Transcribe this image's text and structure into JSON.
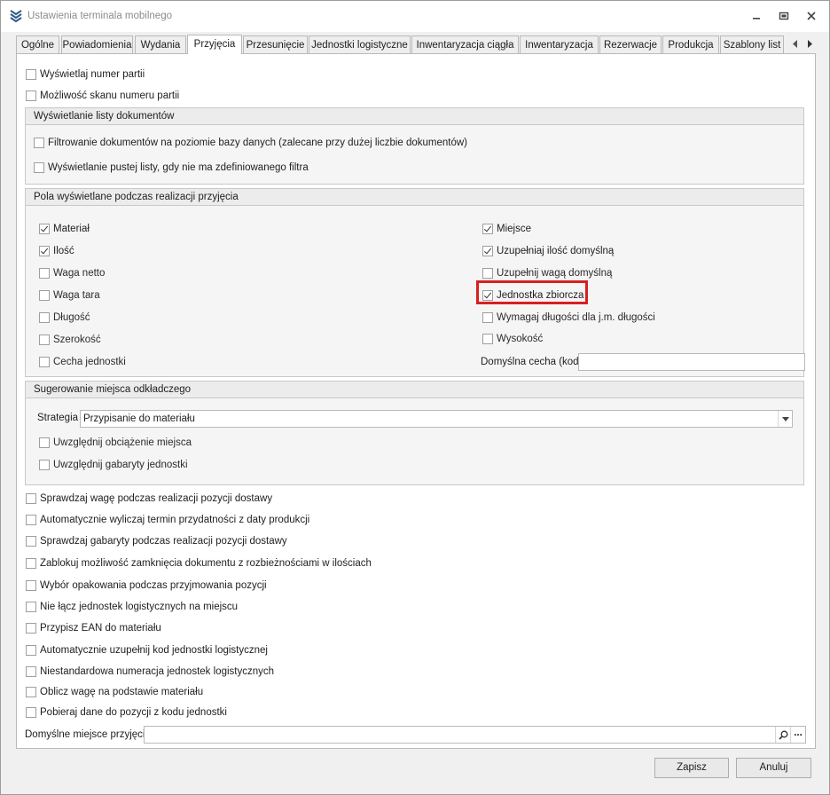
{
  "window": {
    "title": "Ustawienia terminala mobilnego",
    "icon": "app-logo-icon"
  },
  "tabs": [
    {
      "label": "Ogólne"
    },
    {
      "label": "Powiadomienia"
    },
    {
      "label": "Wydania"
    },
    {
      "label": "Przyjęcia",
      "active": true
    },
    {
      "label": "Przesunięcie"
    },
    {
      "label": "Jednostki logistyczne"
    },
    {
      "label": "Inwentaryzacja ciągła"
    },
    {
      "label": "Inwentaryzacja"
    },
    {
      "label": "Rezerwacje"
    },
    {
      "label": "Produkcja"
    },
    {
      "label": "Szablony list"
    }
  ],
  "top_options": [
    {
      "label": "Wyświetlaj numer partii",
      "checked": false
    },
    {
      "label": "Możliwość skanu numeru partii",
      "checked": false
    }
  ],
  "doc_list_group": {
    "title": "Wyświetlanie listy dokumentów",
    "options": [
      {
        "label": "Filtrowanie dokumentów na poziomie bazy danych (zalecane przy dużej liczbie dokumentów)",
        "checked": false
      },
      {
        "label": "Wyświetlanie pustej listy, gdy nie ma zdefiniowanego filtra",
        "checked": false
      }
    ]
  },
  "fields_group": {
    "title": "Pola wyświetlane podczas realizacji przyjęcia",
    "left": [
      {
        "label": "Materiał",
        "checked": true
      },
      {
        "label": "Ilość",
        "checked": true
      },
      {
        "label": "Waga netto",
        "checked": false
      },
      {
        "label": "Waga tara",
        "checked": false
      },
      {
        "label": "Długość",
        "checked": false
      },
      {
        "label": "Szerokość",
        "checked": false
      },
      {
        "label": "Cecha jednostki",
        "checked": false
      }
    ],
    "right": [
      {
        "label": "Miejsce",
        "checked": true
      },
      {
        "label": "Uzupełniaj ilość domyślną",
        "checked": true
      },
      {
        "label": "Uzupełnij wagą domyślną",
        "checked": false
      },
      {
        "label": "Jednostka zbiorcza",
        "checked": true,
        "highlighted": true
      },
      {
        "label": "Wymagaj długości dla j.m. długości",
        "checked": false
      },
      {
        "label": "Wysokość",
        "checked": false
      }
    ],
    "default_feature_label": "Domyślna cecha (kod)",
    "default_feature_value": ""
  },
  "location_group": {
    "title": "Sugerowanie miejsca odkładczego",
    "strategy_label": "Strategia",
    "strategy_value": "Przypisanie do materiału",
    "options": [
      {
        "label": "Uwzględnij obciążenie miejsca",
        "checked": false
      },
      {
        "label": "Uwzględnij gabaryty jednostki",
        "checked": false
      }
    ]
  },
  "bottom_options": [
    {
      "label": "Sprawdzaj wagę podczas realizacji pozycji dostawy",
      "checked": false
    },
    {
      "label": "Automatycznie wyliczaj termin przydatności z daty produkcji",
      "checked": false
    },
    {
      "label": "Sprawdzaj gabaryty podczas realizacji pozycji dostawy",
      "checked": false
    },
    {
      "label": "Zablokuj możliwość zamknięcia dokumentu z rozbieżnościami w ilościach",
      "checked": false
    },
    {
      "label": "Wybór opakowania podczas przyjmowania pozycji",
      "checked": false
    },
    {
      "label": "Nie łącz jednostek logistycznych na miejscu",
      "checked": false
    },
    {
      "label": "Przypisz EAN do materiału",
      "checked": false
    },
    {
      "label": "Automatycznie uzupełnij kod jednostki logistycznej",
      "checked": false
    },
    {
      "label": "Niestandardowa numeracja jednostek logistycznych",
      "checked": false
    },
    {
      "label": "Oblicz wagę na podstawie materiału",
      "checked": false
    },
    {
      "label": "Pobieraj dane do pozycji z kodu jednostki",
      "checked": false
    }
  ],
  "default_location": {
    "label": "Domyślne miejsce przyjęcia",
    "value": "",
    "search_icon": "search-icon",
    "more_label": "..."
  },
  "buttons": {
    "save": "Zapisz",
    "cancel": "Anuluj"
  },
  "colors": {
    "highlight": "#d82020",
    "title_text": "#8c8c8c",
    "group_header_bg": "#ececec"
  }
}
